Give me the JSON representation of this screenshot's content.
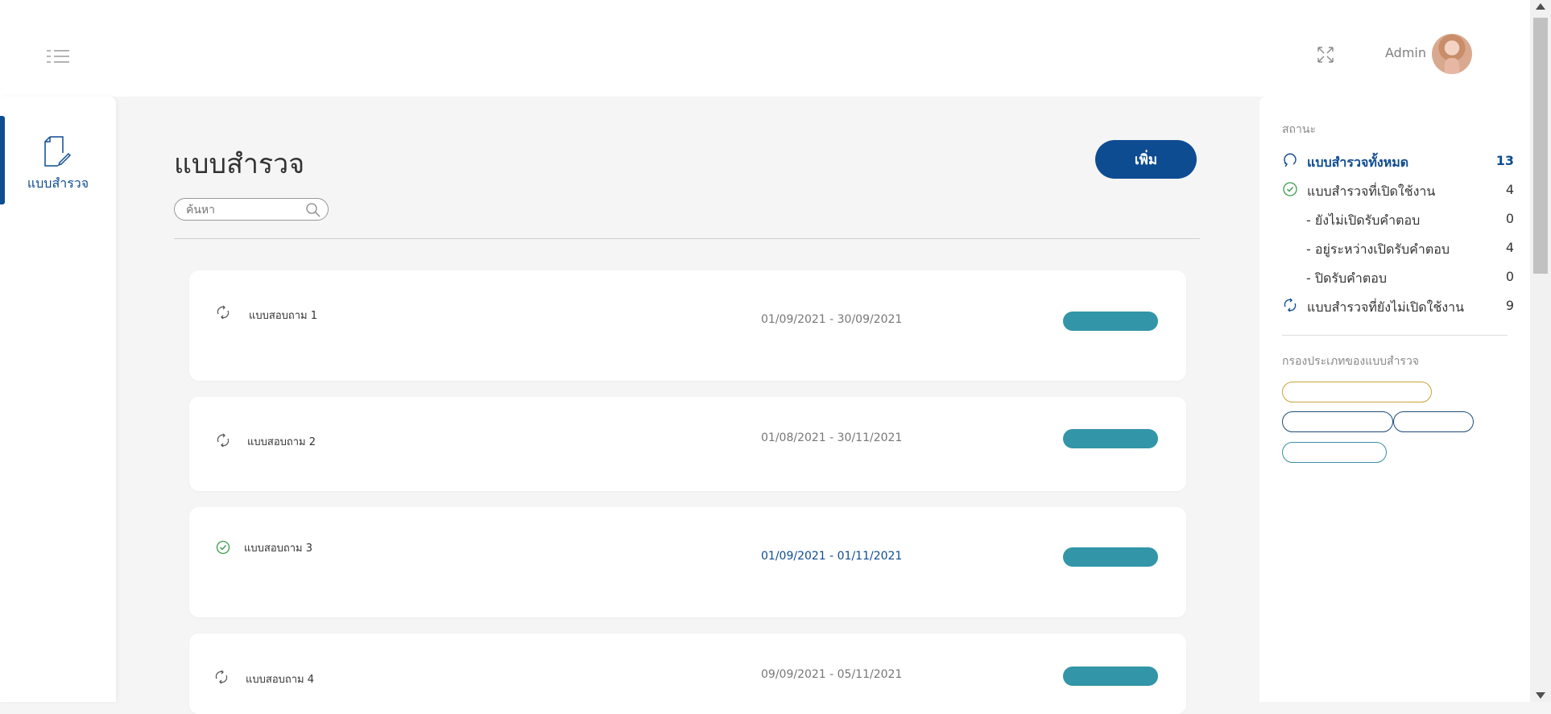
{
  "header": {
    "menu_icon": "list-menu-icon",
    "fullscreen_icon": "expand-icon",
    "user_name": "Admin",
    "avatar": "user-avatar"
  },
  "sidebar": {
    "items": [
      {
        "label": "แบบสำรวจ",
        "icon": "document-edit-icon",
        "active": true
      }
    ]
  },
  "main": {
    "title": "แบบสำรวจ",
    "add_label": "เพิ่ม",
    "search_placeholder": "ค้นหา",
    "surveys": [
      {
        "name": "แบบสอบถาม 1",
        "dates": "01/09/2021 - 30/09/2021",
        "status": "inactive",
        "status_icon": "sync-icon"
      },
      {
        "name": "แบบสอบถาม 2",
        "dates": "01/08/2021 - 30/11/2021",
        "status": "inactive",
        "status_icon": "sync-icon"
      },
      {
        "name": "แบบสอบถาม 3",
        "dates": "01/09/2021 - 01/11/2021",
        "status": "active",
        "status_icon": "check-circle-icon"
      },
      {
        "name": "แบบสอบถาม 4",
        "dates": "09/09/2021 - 05/11/2021",
        "status": "inactive",
        "status_icon": "sync-icon"
      }
    ]
  },
  "right_panel": {
    "status_heading": "สถานะ",
    "status_items": [
      {
        "label": "แบบสำรวจทั้งหมด",
        "count": "13",
        "icon": "refresh-icon",
        "selected": true
      },
      {
        "label": "แบบสำรวจที่เปิดใช้งาน",
        "count": "4",
        "icon": "check-circle-icon"
      },
      {
        "label": "- ยังไม่เปิดรับคำตอบ",
        "count": "0"
      },
      {
        "label": "- อยู่ระหว่างเปิดรับคำตอบ",
        "count": "4"
      },
      {
        "label": "- ปิดรับคำตอบ",
        "count": "0"
      },
      {
        "label": "แบบสำรวจที่ยังไม่เปิดใช้งาน",
        "count": "9",
        "icon": "sync-icon"
      }
    ],
    "filter_heading": "กรองประเภทของแบบสำรวจ"
  },
  "colors": {
    "primary": "#0e4c92",
    "pill": "#3395a8",
    "success": "#3a9a4a",
    "chip_gold": "#c9a33d",
    "chip_navy": "#1f4d7a",
    "chip_teal": "#3a8fa0"
  }
}
